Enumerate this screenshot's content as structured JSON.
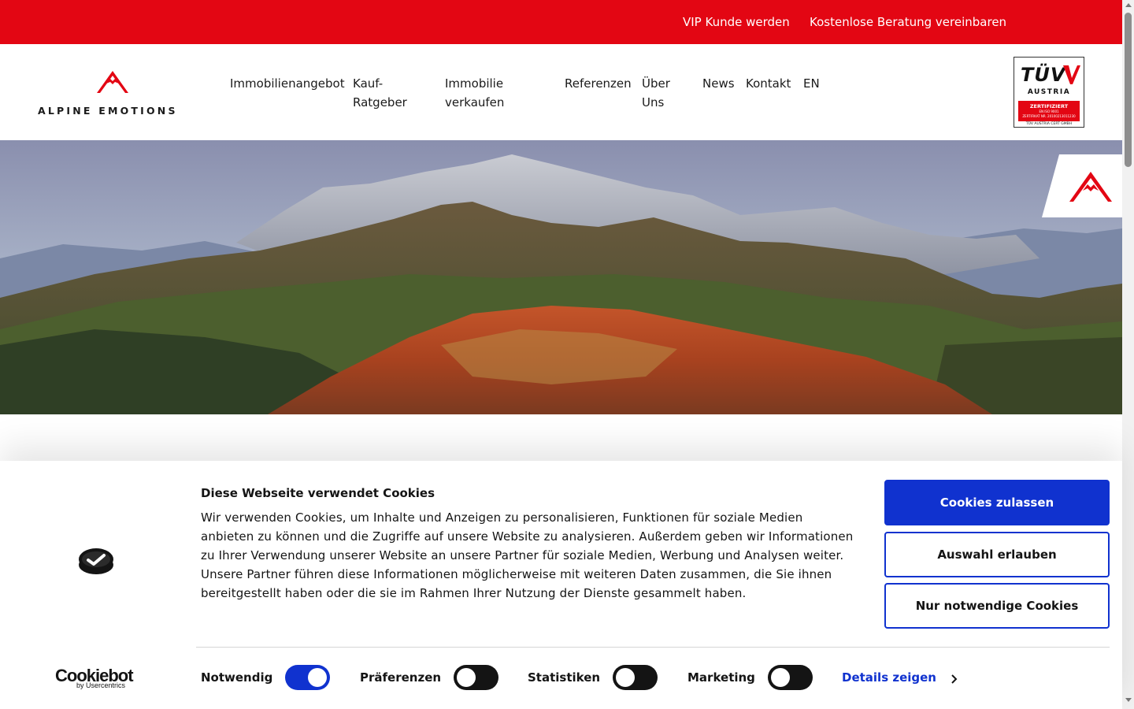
{
  "topbar": {
    "vip_link": "VIP Kunde werden",
    "beratung_link": "Kostenlose Beratung vereinbaren",
    "color": "#e30613"
  },
  "header": {
    "logo_text": "ALPINE EMOTIONS",
    "nav": [
      {
        "label": "Immobilienangebot"
      },
      {
        "label": "Kauf-Ratgeber"
      },
      {
        "label": "Immobilie verkaufen"
      },
      {
        "label": "Referenzen"
      },
      {
        "label": "Über Uns"
      },
      {
        "label": "News"
      },
      {
        "label": "Kontakt"
      },
      {
        "label": "EN"
      }
    ],
    "certificate": {
      "brand": "TÜV",
      "sub": "AUSTRIA",
      "line1": "ZERTIFIZIERT",
      "line2": "EN ISO 9001",
      "line3": "ZERTIFIKAT NR. 20100213011230",
      "footer": "TÜV AUSTRIA CERT GMBH"
    }
  },
  "hero": {
    "icon": "mountain-landscape",
    "badge_icon": "alpine-emotions-mark-icon"
  },
  "cookie_banner": {
    "title": "Diese Webseite verwendet Cookies",
    "text": "Wir verwenden Cookies, um Inhalte und Anzeigen zu personalisieren, Funktionen für soziale Medien anbieten zu können und die Zugriffe auf unsere Website zu analysieren. Außerdem geben wir Informationen zu Ihrer Verwendung unserer Website an unsere Partner für soziale Medien, Werbung und Analysen weiter. Unsere Partner führen diese Informationen möglicherweise mit weiteren Daten zusammen, die Sie ihnen bereitgestellt haben oder die sie im Rahmen Ihrer Nutzung der Dienste gesammelt haben.",
    "buttons": {
      "allow_all": "Cookies zulassen",
      "allow_selection": "Auswahl erlauben",
      "necessary_only": "Nur notwendige Cookies"
    },
    "toggles": [
      {
        "label": "Notwendig",
        "on": true
      },
      {
        "label": "Präferenzen",
        "on": false
      },
      {
        "label": "Statistiken",
        "on": false
      },
      {
        "label": "Marketing",
        "on": false
      }
    ],
    "details_link": "Details zeigen",
    "brand": "Cookiebot",
    "brand_sub": "by Usercentrics",
    "accent_color": "#1032cf"
  }
}
